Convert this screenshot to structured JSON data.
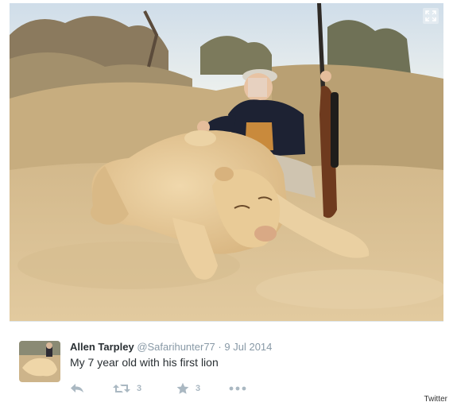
{
  "tweet": {
    "author_name": "Allen Tarpley",
    "author_handle": "@Safarihunter77",
    "separator": "·",
    "date": "9 Jul 2014",
    "text": "My 7 year old with his first lion",
    "retweet_count": "3",
    "favorite_count": "3"
  },
  "icons": {
    "expand": "expand-icon",
    "reply": "reply-icon",
    "retweet": "retweet-icon",
    "favorite": "star-icon",
    "more": "more-icon"
  },
  "colors": {
    "name_text": "#292f33",
    "meta_text": "#8899a6",
    "action_icons": "#aab8c2",
    "sky": "#dfe8f0",
    "sand": "#dcc49a"
  },
  "credit": "Twitter"
}
